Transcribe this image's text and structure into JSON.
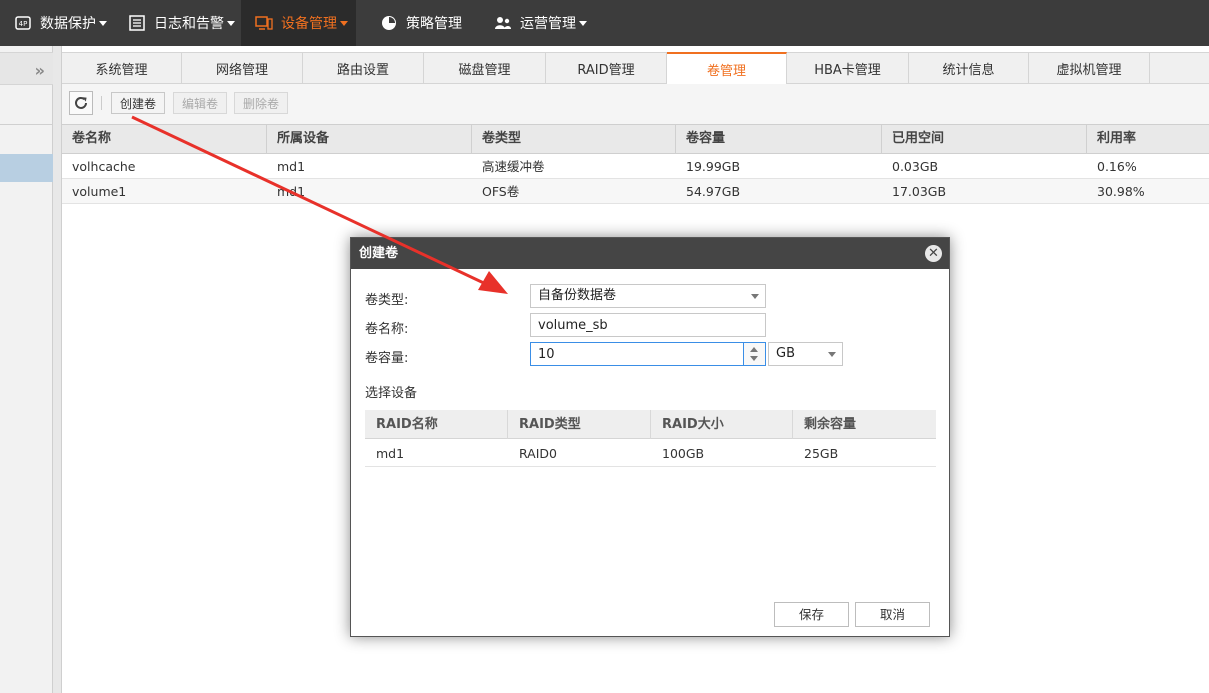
{
  "topnav": {
    "items": [
      {
        "label": "数据保护",
        "icon": "shield-icon",
        "has_caret": true
      },
      {
        "label": "日志和告警",
        "icon": "log-icon",
        "has_caret": true
      },
      {
        "label": "设备管理",
        "icon": "device-icon",
        "has_caret": true,
        "active": true
      },
      {
        "label": "策略管理",
        "icon": "clock-icon",
        "has_caret": false
      },
      {
        "label": "运营管理",
        "icon": "users-icon",
        "has_caret": true
      }
    ]
  },
  "sidebar": {
    "collapse_glyph": "»"
  },
  "tabs": [
    "系统管理",
    "网络管理",
    "路由设置",
    "磁盘管理",
    "RAID管理",
    "卷管理",
    "HBA卡管理",
    "统计信息",
    "虚拟机管理"
  ],
  "active_tab": "卷管理",
  "toolbar": {
    "refresh_icon": "refresh-icon",
    "create_label": "创建卷",
    "edit_label": "编辑卷",
    "delete_label": "删除卷"
  },
  "grid": {
    "columns": [
      "卷名称",
      "所属设备",
      "卷类型",
      "卷容量",
      "已用空间",
      "利用率"
    ],
    "rows": [
      [
        "volhcache",
        "md1",
        "高速缓冲卷",
        "19.99GB",
        "0.03GB",
        "0.16%"
      ],
      [
        "volume1",
        "md1",
        "OFS卷",
        "54.97GB",
        "17.03GB",
        "30.98%"
      ]
    ]
  },
  "dialog": {
    "title": "创建卷",
    "close_glyph": "✕",
    "type_label": "卷类型:",
    "type_value": "自备份数据卷",
    "name_label": "卷名称:",
    "name_value": "volume_sb",
    "size_label": "卷容量:",
    "size_value": "10",
    "unit_value": "GB",
    "device_section": "选择设备",
    "device_columns": [
      "RAID名称",
      "RAID类型",
      "RAID大小",
      "剩余容量"
    ],
    "device_rows": [
      [
        "md1",
        "RAID0",
        "100GB",
        "25GB"
      ]
    ],
    "save_label": "保存",
    "cancel_label": "取消"
  },
  "colors": {
    "accent": "#f07020",
    "arrow": "#e8312a",
    "nav_bg": "#3c3c3c"
  }
}
